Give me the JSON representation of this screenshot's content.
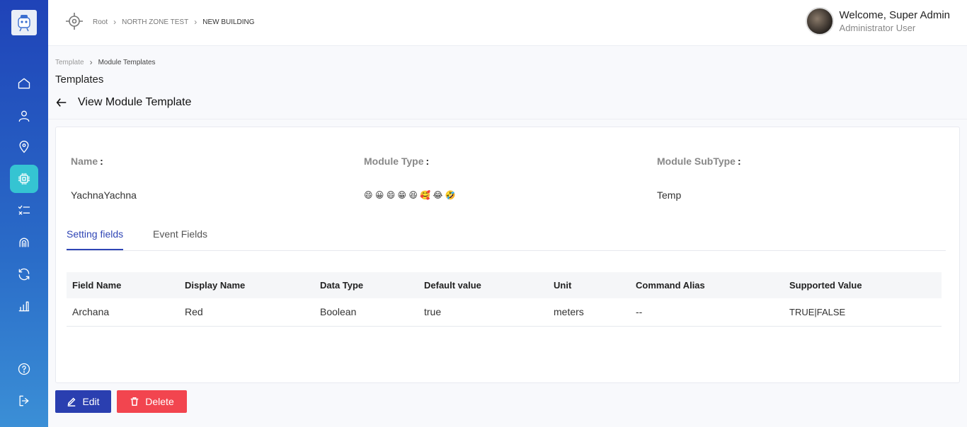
{
  "header": {
    "breadcrumb": [
      "Root",
      "NORTH ZONE TEST",
      "NEW BUILDING"
    ],
    "welcome": "Welcome, Super Admin",
    "role": "Administrator User"
  },
  "sub_breadcrumb": [
    "Template",
    "Module Templates"
  ],
  "section_title": "Templates",
  "view_title": "View Module Template",
  "details": {
    "name_label": "Name",
    "name_value": "YachnaYachna",
    "type_label": "Module Type",
    "type_value": "😄 😀 😄 😁 😆 🥰 😂 🤣",
    "subtype_label": "Module SubType",
    "subtype_value": "Temp",
    "colon": ":"
  },
  "tabs": [
    "Setting fields",
    "Event Fields"
  ],
  "table": {
    "headers": [
      "Field Name",
      "Display Name",
      "Data Type",
      "Default value",
      "Unit",
      "Command Alias",
      "Supported Value"
    ],
    "rows": [
      [
        "Archana",
        "Red",
        "Boolean",
        "true",
        "meters",
        "--",
        "TRUE|FALSE"
      ]
    ]
  },
  "buttons": {
    "edit": "Edit",
    "delete": "Delete"
  },
  "colors": {
    "sidebar": "#1f43b8",
    "active_nav": "#35c4d2",
    "primary": "#2a3fb0",
    "danger": "#f2454f",
    "tab_active": "#2f45b5"
  },
  "icons": [
    "home-icon",
    "user-icon",
    "location-icon",
    "chip-icon",
    "checklist-icon",
    "fingerprint-icon",
    "refresh-icon",
    "bar-chart-icon",
    "help-icon",
    "logout-icon"
  ]
}
